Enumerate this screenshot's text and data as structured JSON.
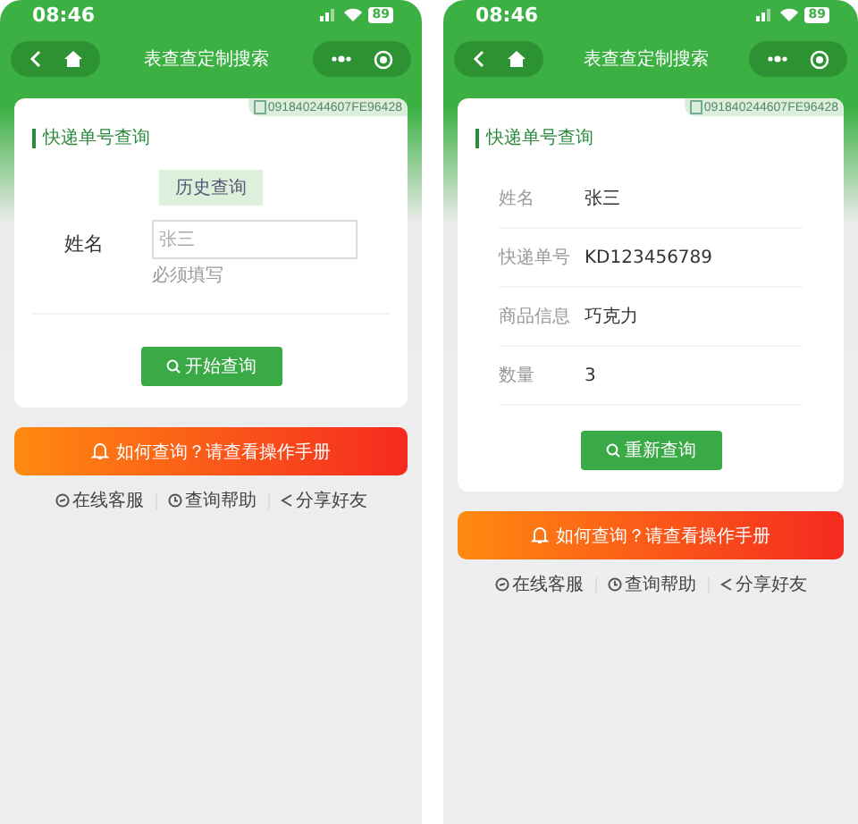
{
  "screens": [
    {
      "kind": "form",
      "status_bar": {
        "time": "08:46",
        "battery": "89"
      },
      "nav": {
        "title": "表查查定制搜索"
      },
      "card": {
        "code": "091840244607FE96428",
        "heading": "快递单号查询",
        "history_button": "历史查询",
        "field": {
          "label": "姓名",
          "placeholder": "张三",
          "hint": "必须填写"
        },
        "button": "开始查询"
      },
      "banner": "如何查询？请查看操作手册",
      "links": [
        {
          "kind": "service",
          "label": "在线客服"
        },
        {
          "kind": "help",
          "label": "查询帮助"
        },
        {
          "kind": "share",
          "label": "分享好友"
        }
      ]
    },
    {
      "kind": "result",
      "status_bar": {
        "time": "08:46",
        "battery": "89"
      },
      "nav": {
        "title": "表查查定制搜索"
      },
      "card": {
        "code": "091840244607FE96428",
        "heading": "快递单号查询",
        "rows": [
          {
            "label": "姓名",
            "value": "张三"
          },
          {
            "label": "快递单号",
            "value": "KD123456789"
          },
          {
            "label": "商品信息",
            "value": "巧克力"
          },
          {
            "label": "数量",
            "value": "3"
          }
        ],
        "button": "重新查询"
      },
      "banner": "如何查询？请查看操作手册",
      "links": [
        {
          "kind": "service",
          "label": "在线客服"
        },
        {
          "kind": "help",
          "label": "查询帮助"
        },
        {
          "kind": "share",
          "label": "分享好友"
        }
      ]
    }
  ]
}
